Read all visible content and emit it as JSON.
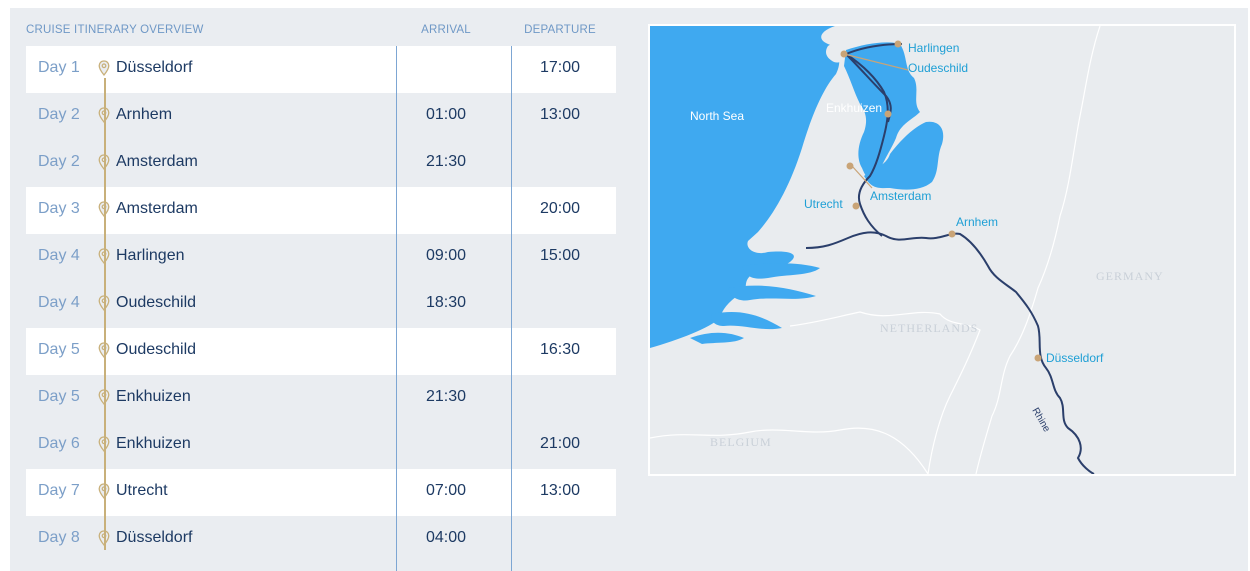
{
  "table": {
    "title": "CRUISE ITINERARY OVERVIEW",
    "arrival_header": "ARRIVAL",
    "departure_header": "DEPARTURE",
    "rows": [
      {
        "day": "Day 1",
        "city": "Düsseldorf",
        "arrival": "",
        "departure": "17:00"
      },
      {
        "day": "Day 2",
        "city": "Arnhem",
        "arrival": "01:00",
        "departure": "13:00"
      },
      {
        "day": "Day 2",
        "city": "Amsterdam",
        "arrival": "21:30",
        "departure": ""
      },
      {
        "day": "Day 3",
        "city": "Amsterdam",
        "arrival": "",
        "departure": "20:00"
      },
      {
        "day": "Day 4",
        "city": "Harlingen",
        "arrival": "09:00",
        "departure": "15:00"
      },
      {
        "day": "Day 4",
        "city": "Oudeschild",
        "arrival": "18:30",
        "departure": ""
      },
      {
        "day": "Day 5",
        "city": "Oudeschild",
        "arrival": "",
        "departure": "16:30"
      },
      {
        "day": "Day 5",
        "city": "Enkhuizen",
        "arrival": "21:30",
        "departure": ""
      },
      {
        "day": "Day 6",
        "city": "Enkhuizen",
        "arrival": "",
        "departure": "21:00"
      },
      {
        "day": "Day 7",
        "city": "Utrecht",
        "arrival": "07:00",
        "departure": "13:00"
      },
      {
        "day": "Day 8",
        "city": "Düsseldorf",
        "arrival": "04:00",
        "departure": ""
      }
    ]
  },
  "map": {
    "labels": {
      "harlingen": "Harlingen",
      "oudeschild": "Oudeschild",
      "north_sea": "North Sea",
      "enkhuizen": "Enkhuizen",
      "amsterdam": "Amsterdam",
      "utrecht": "Utrecht",
      "arnhem": "Arnhem",
      "germany": "GERMANY",
      "netherlands": "NETHERLANDS",
      "dusseldorf": "Düsseldorf",
      "rhine": "Rhine",
      "belgium": "BELGIUM"
    }
  },
  "colors": {
    "water": "#3fa9f0",
    "route": "#2b3f6b",
    "city_dot": "#c9a477",
    "city_label": "#1e9fd5",
    "pin": "#c8b07a"
  }
}
